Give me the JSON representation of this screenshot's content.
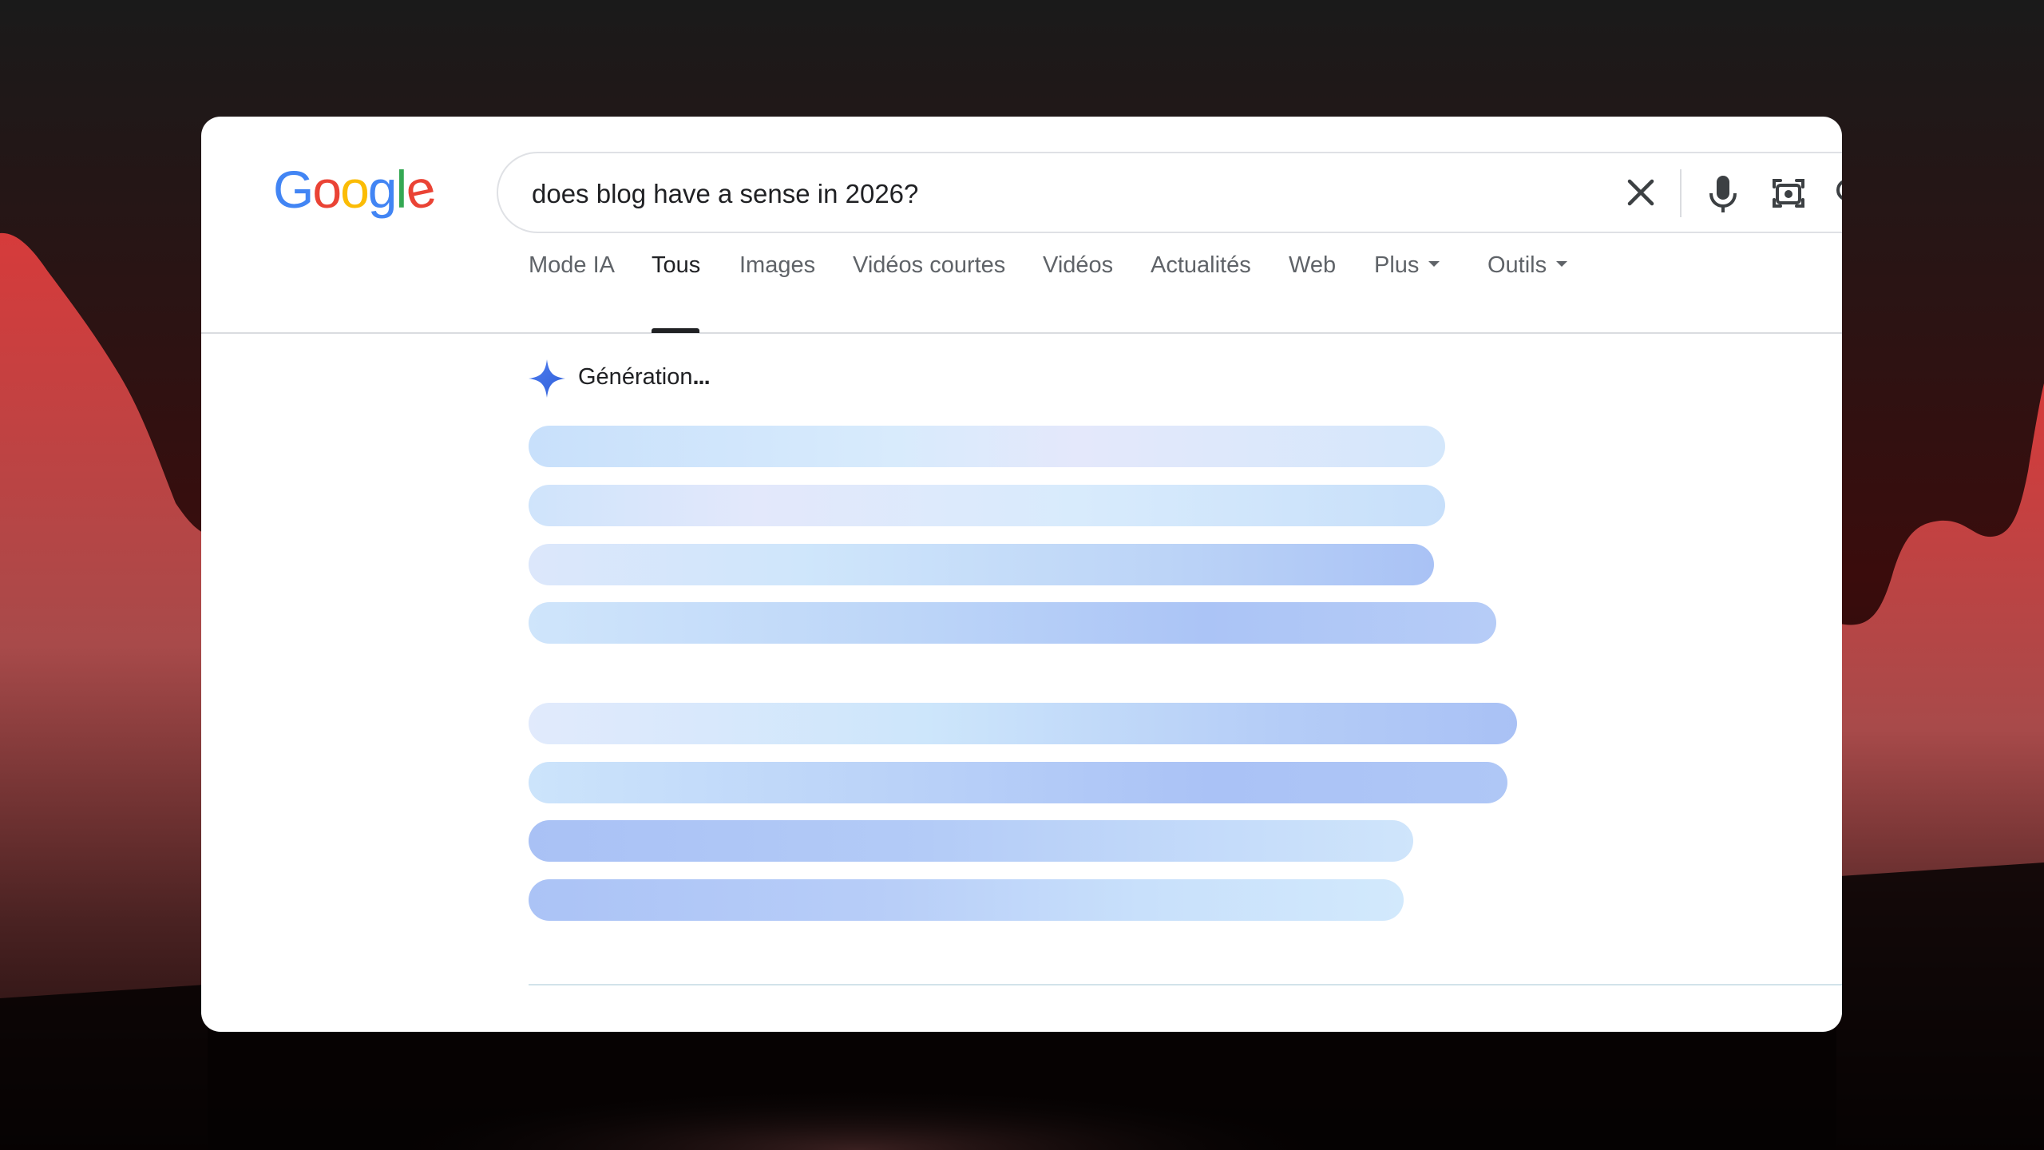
{
  "logo": {
    "letters": [
      "G",
      "o",
      "o",
      "g",
      "l",
      "e"
    ],
    "colors": [
      "#4285F4",
      "#EA4335",
      "#FBBC05",
      "#4285F4",
      "#34A853",
      "#EA4335"
    ]
  },
  "search": {
    "query": "does blog have a sense in 2026?"
  },
  "icons": {
    "clear": "close-icon",
    "mic": "microphone-icon",
    "lens": "camera-lens-icon",
    "search": "search-icon",
    "spark": "gemini-spark-icon"
  },
  "tabs": [
    {
      "label": "Mode IA"
    },
    {
      "label": "Tous"
    },
    {
      "label": "Images"
    },
    {
      "label": "Vidéos courtes"
    },
    {
      "label": "Vidéos"
    },
    {
      "label": "Actualités"
    },
    {
      "label": "Web"
    },
    {
      "label": "Plus"
    },
    {
      "label": "Outils"
    }
  ],
  "active_tab": "Tous",
  "ai_overview": {
    "status": "Génération",
    "dots": "..."
  },
  "colors": {
    "accent_blue": "#4285F4",
    "bar_light": "#d3e8fb",
    "bar_dark": "#aac4f6",
    "background_red": "#c62f2f"
  }
}
